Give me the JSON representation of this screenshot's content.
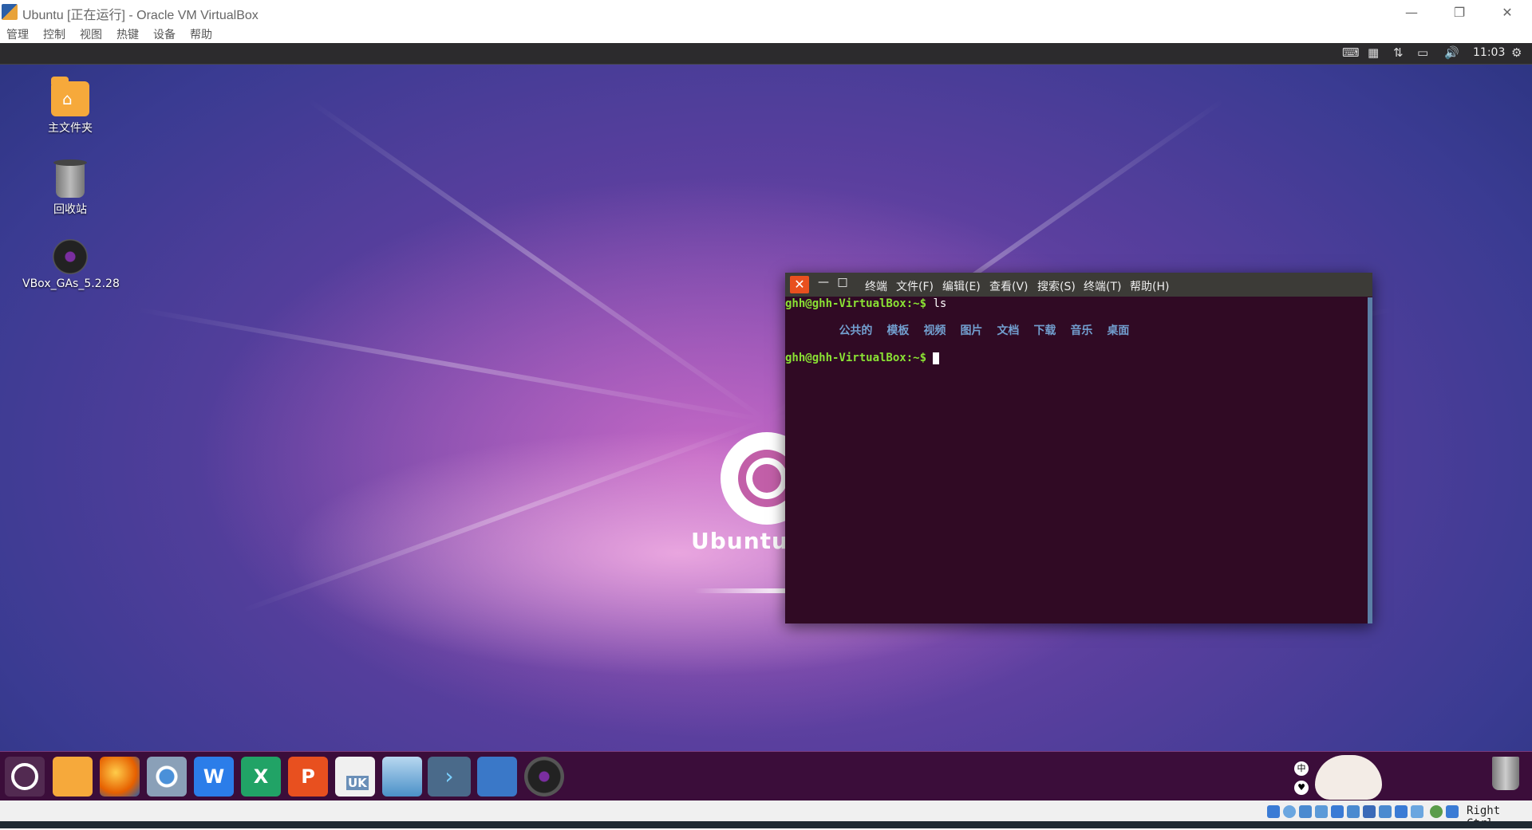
{
  "host": {
    "title": "Ubuntu [正在运行] - Oracle VM VirtualBox",
    "window_controls": {
      "minimize": "—",
      "restore": "❐",
      "close": "✕"
    },
    "menu": [
      "管理",
      "控制",
      "视图",
      "热键",
      "设备",
      "帮助"
    ]
  },
  "panel": {
    "clock": "11:03",
    "indicators": [
      "keyboard-icon",
      "calendar-icon",
      "network-icon",
      "battery-icon",
      "volume-icon",
      "gear-icon"
    ]
  },
  "desktop": {
    "icons": [
      {
        "label": "主文件夹",
        "icon": "home-folder-icon"
      },
      {
        "label": "回收站",
        "icon": "trash-icon"
      },
      {
        "label": "VBox_GAs_5.2.28",
        "icon": "disc-icon"
      }
    ],
    "logo_text": "Ubuntu"
  },
  "terminal": {
    "controls": {
      "close": "✕",
      "minimize": "—",
      "maximize": "□"
    },
    "menu": [
      "终端",
      "文件(F)",
      "编辑(E)",
      "查看(V)",
      "搜索(S)",
      "终端(T)",
      "帮助(H)"
    ],
    "prompt": "ghh@ghh-VirtualBox:~$",
    "command": " ls",
    "dirs": [
      "公共的",
      "模板",
      "视频",
      "图片",
      "文档",
      "下载",
      "音乐",
      "桌面"
    ],
    "prompt2": "ghh@ghh-VirtualBox:~$"
  },
  "dock": {
    "items": [
      {
        "name": "ubuntu-launcher-icon",
        "color": "#5e2750"
      },
      {
        "name": "files-icon",
        "color": "#f6a93b"
      },
      {
        "name": "firefox-icon",
        "color": "#e66000"
      },
      {
        "name": "chromium-icon",
        "color": "#4a90d9"
      },
      {
        "name": "wps-writer-icon",
        "color": "#2b7de9"
      },
      {
        "name": "wps-spreadsheet-icon",
        "color": "#21a366"
      },
      {
        "name": "wps-presentation-icon",
        "color": "#e8501f"
      },
      {
        "name": "ubuntu-kylin-store-icon",
        "color": "#f0f0f0"
      },
      {
        "name": "software-updater-icon",
        "color": "#7ab8e0"
      },
      {
        "name": "terminal-icon",
        "color": "#4a6a8a"
      },
      {
        "name": "workspace-switcher-icon",
        "color": "#3a78c8"
      },
      {
        "name": "vbox-disc-icon",
        "color": "#222222"
      }
    ],
    "store_label": "UK",
    "tray": {
      "ime_top": "中",
      "ime_bottom": "♥"
    }
  },
  "status": {
    "host_key": "Right Ctrl"
  }
}
